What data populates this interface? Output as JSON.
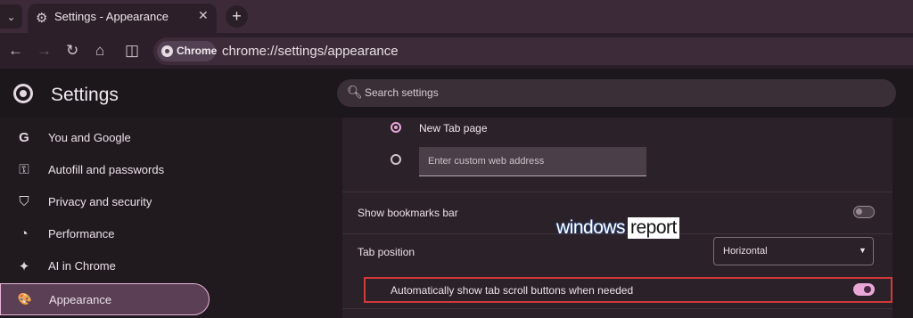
{
  "tab": {
    "title": "Settings - Appearance",
    "close": "✕",
    "new_tab": "+"
  },
  "toolbar": {
    "chip_label": "Chrome",
    "url": "chrome://settings/appearance"
  },
  "header": {
    "title": "Settings",
    "search_placeholder": "Search settings"
  },
  "sidebar": {
    "items": [
      {
        "label": "You and Google",
        "icon": "google-icon",
        "glyph": "G"
      },
      {
        "label": "Autofill and passwords",
        "icon": "key-icon",
        "glyph": "⚿"
      },
      {
        "label": "Privacy and security",
        "icon": "shield-icon",
        "glyph": "⛉"
      },
      {
        "label": "Performance",
        "icon": "gauge-icon",
        "glyph": "◔"
      },
      {
        "label": "AI in Chrome",
        "icon": "sparkle-icon",
        "glyph": "✦"
      },
      {
        "label": "Appearance",
        "icon": "palette-icon",
        "glyph": "🎨",
        "selected": true
      }
    ]
  },
  "content": {
    "radio_new_tab": "New Tab page",
    "custom_url_placeholder": "Enter custom web address",
    "bookmarks_bar": {
      "label": "Show bookmarks bar",
      "enabled": false
    },
    "tab_position": {
      "label": "Tab position",
      "value": "Horizontal"
    },
    "tab_scroll": {
      "label": "Automatically show tab scroll buttons when needed",
      "enabled": true
    }
  },
  "watermark": {
    "part1": "windows",
    "part2": "report"
  },
  "colors": {
    "accent": "#e8a7d6",
    "highlight_border": "#d23a3a",
    "selected_nav": "#5a3f55"
  }
}
